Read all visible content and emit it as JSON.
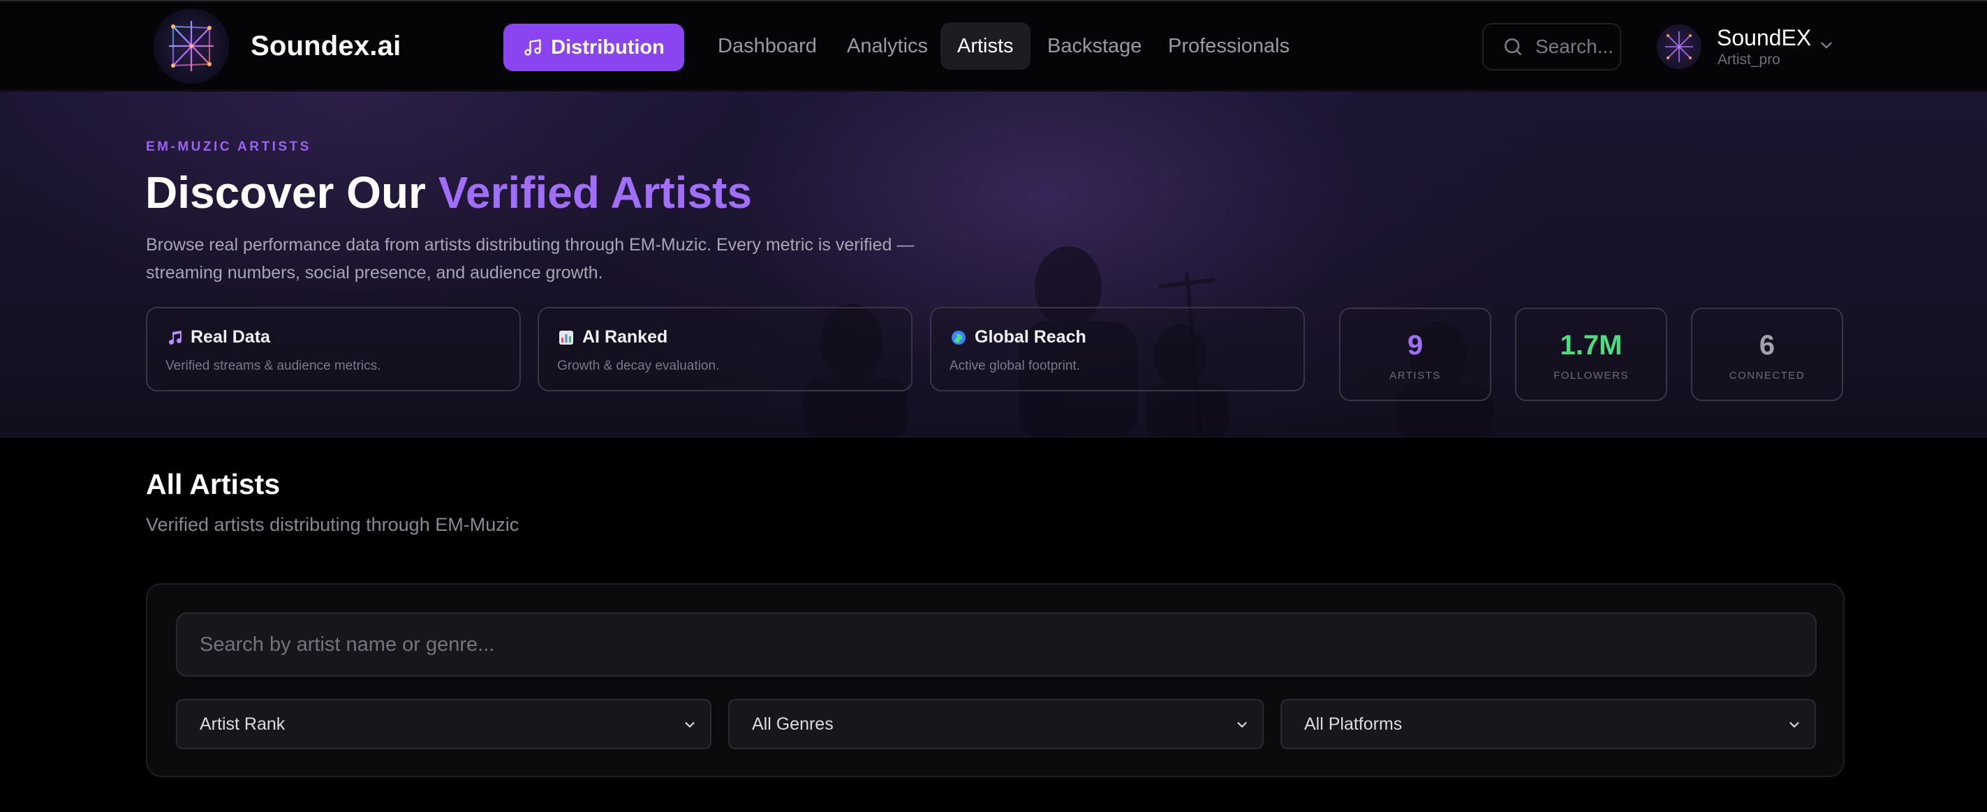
{
  "nav": {
    "brand": "Soundex.ai",
    "distribution_label": "Distribution",
    "links": [
      {
        "label": "Dashboard",
        "active": false
      },
      {
        "label": "Analytics",
        "active": false
      },
      {
        "label": "Artists",
        "active": true
      },
      {
        "label": "Backstage",
        "active": false
      },
      {
        "label": "Professionals",
        "active": false
      }
    ],
    "search_placeholder": "Search...",
    "user": {
      "name": "SoundEX",
      "role": "Artist_pro"
    }
  },
  "hero": {
    "eyebrow": "EM-MUZIC ARTISTS",
    "title_plain": "Discover Our",
    "title_accent": "Verified Artists",
    "description": "Browse real performance data from artists distributing through EM-Muzic. Every metric is verified — streaming numbers, social presence, and audience growth.",
    "features": [
      {
        "icon": "music-note-icon",
        "title": "Real Data",
        "subtitle": "Verified streams & audience metrics."
      },
      {
        "icon": "bar-chart-icon",
        "title": "AI Ranked",
        "subtitle": "Growth & decay evaluation."
      },
      {
        "icon": "globe-icon",
        "title": "Global Reach",
        "subtitle": "Active global footprint."
      }
    ],
    "stats": [
      {
        "value": "9",
        "label": "ARTISTS",
        "color": "#a16ff7"
      },
      {
        "value": "1.7M",
        "label": "FOLLOWERS",
        "color": "#4ade80"
      },
      {
        "value": "6",
        "label": "CONNECTED",
        "color": "#a3a3ad"
      }
    ]
  },
  "section": {
    "title": "All Artists",
    "subtitle": "Verified artists distributing through EM-Muzic",
    "search_placeholder": "Search by artist name or genre...",
    "selects": [
      {
        "value": "Artist Rank"
      },
      {
        "value": "All Genres"
      },
      {
        "value": "All Platforms"
      }
    ]
  },
  "colors": {
    "accent": "#8b45f0",
    "accent_text": "#a16ff7",
    "success": "#4ade80"
  }
}
